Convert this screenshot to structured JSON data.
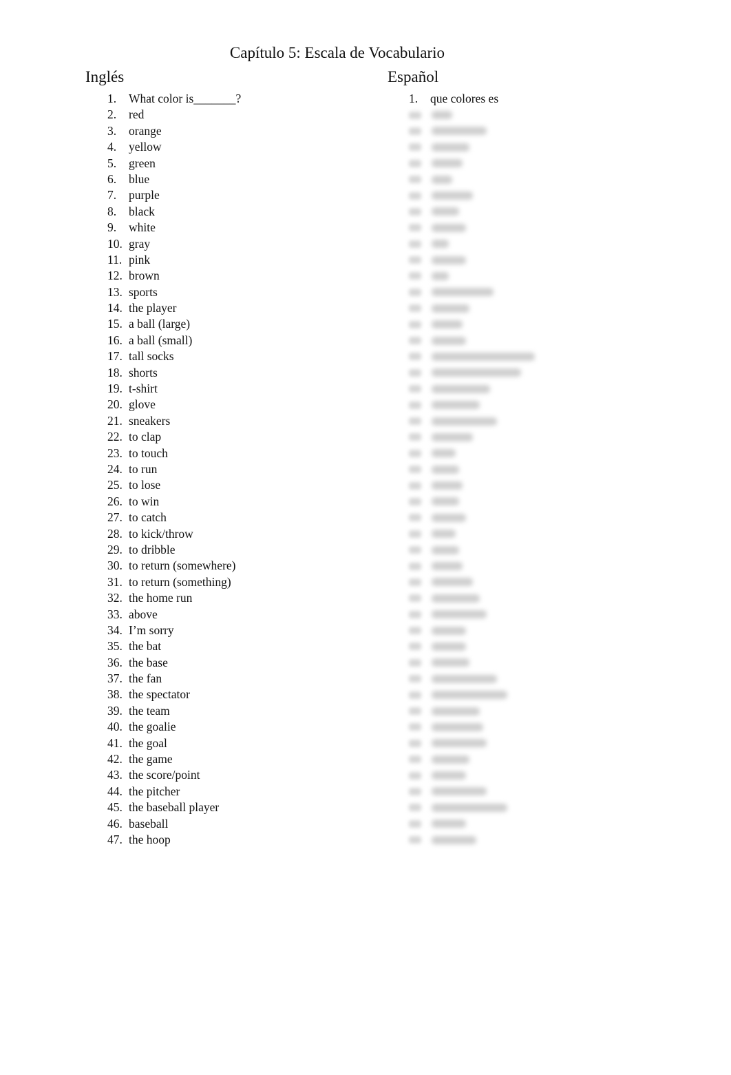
{
  "document": {
    "title": "Capítulo 5: Escala de Vocabulario",
    "columns": {
      "english_header": "Inglés",
      "spanish_header": "Español"
    },
    "english_items": [
      {
        "num": "1.",
        "text": "What color is_______?"
      },
      {
        "num": "2.",
        "text": "red"
      },
      {
        "num": "3.",
        "text": "orange"
      },
      {
        "num": "4.",
        "text": "yellow"
      },
      {
        "num": "5.",
        "text": "green"
      },
      {
        "num": "6.",
        "text": "blue"
      },
      {
        "num": "7.",
        "text": "purple"
      },
      {
        "num": "8.",
        "text": "black"
      },
      {
        "num": "9.",
        "text": "white"
      },
      {
        "num": "10.",
        "text": "gray"
      },
      {
        "num": "11.",
        "text": "pink"
      },
      {
        "num": "12.",
        "text": "brown"
      },
      {
        "num": "13.",
        "text": "sports"
      },
      {
        "num": "14.",
        "text": "the player"
      },
      {
        "num": "15.",
        "text": "a ball (large)"
      },
      {
        "num": "16.",
        "text": "a ball (small)"
      },
      {
        "num": "17.",
        "text": "tall socks"
      },
      {
        "num": "18.",
        "text": "shorts"
      },
      {
        "num": "19.",
        "text": "t-shirt"
      },
      {
        "num": "20.",
        "text": "glove"
      },
      {
        "num": "21.",
        "text": "sneakers"
      },
      {
        "num": "22.",
        "text": "to clap"
      },
      {
        "num": "23.",
        "text": "to touch"
      },
      {
        "num": "24.",
        "text": "to run"
      },
      {
        "num": "25.",
        "text": "to lose"
      },
      {
        "num": "26.",
        "text": "to win"
      },
      {
        "num": "27.",
        "text": "to catch"
      },
      {
        "num": "28.",
        "text": "to kick/throw"
      },
      {
        "num": "29.",
        "text": "to dribble"
      },
      {
        "num": "30.",
        "text": "to return (somewhere)"
      },
      {
        "num": "31.",
        "text": "to return (something)"
      },
      {
        "num": "32.",
        "text": "the home run"
      },
      {
        "num": "33.",
        "text": "above"
      },
      {
        "num": "34.",
        "text": "I’m sorry"
      },
      {
        "num": "35.",
        "text": "the bat"
      },
      {
        "num": "36.",
        "text": "the base"
      },
      {
        "num": "37.",
        "text": "the fan"
      },
      {
        "num": "38.",
        "text": "the spectator"
      },
      {
        "num": "39.",
        "text": "the team"
      },
      {
        "num": "40.",
        "text": "the goalie"
      },
      {
        "num": "41.",
        "text": "the goal"
      },
      {
        "num": "42.",
        "text": "the game"
      },
      {
        "num": "43.",
        "text": "the score/point"
      },
      {
        "num": "44.",
        "text": "the pitcher"
      },
      {
        "num": "45.",
        "text": "the baseball player"
      },
      {
        "num": "46.",
        "text": "baseball"
      },
      {
        "num": "47.",
        "text": "the hoop"
      }
    ],
    "spanish_items": [
      {
        "num": "1.",
        "text": "que colores es"
      }
    ],
    "spanish_blurred_count": 46
  }
}
